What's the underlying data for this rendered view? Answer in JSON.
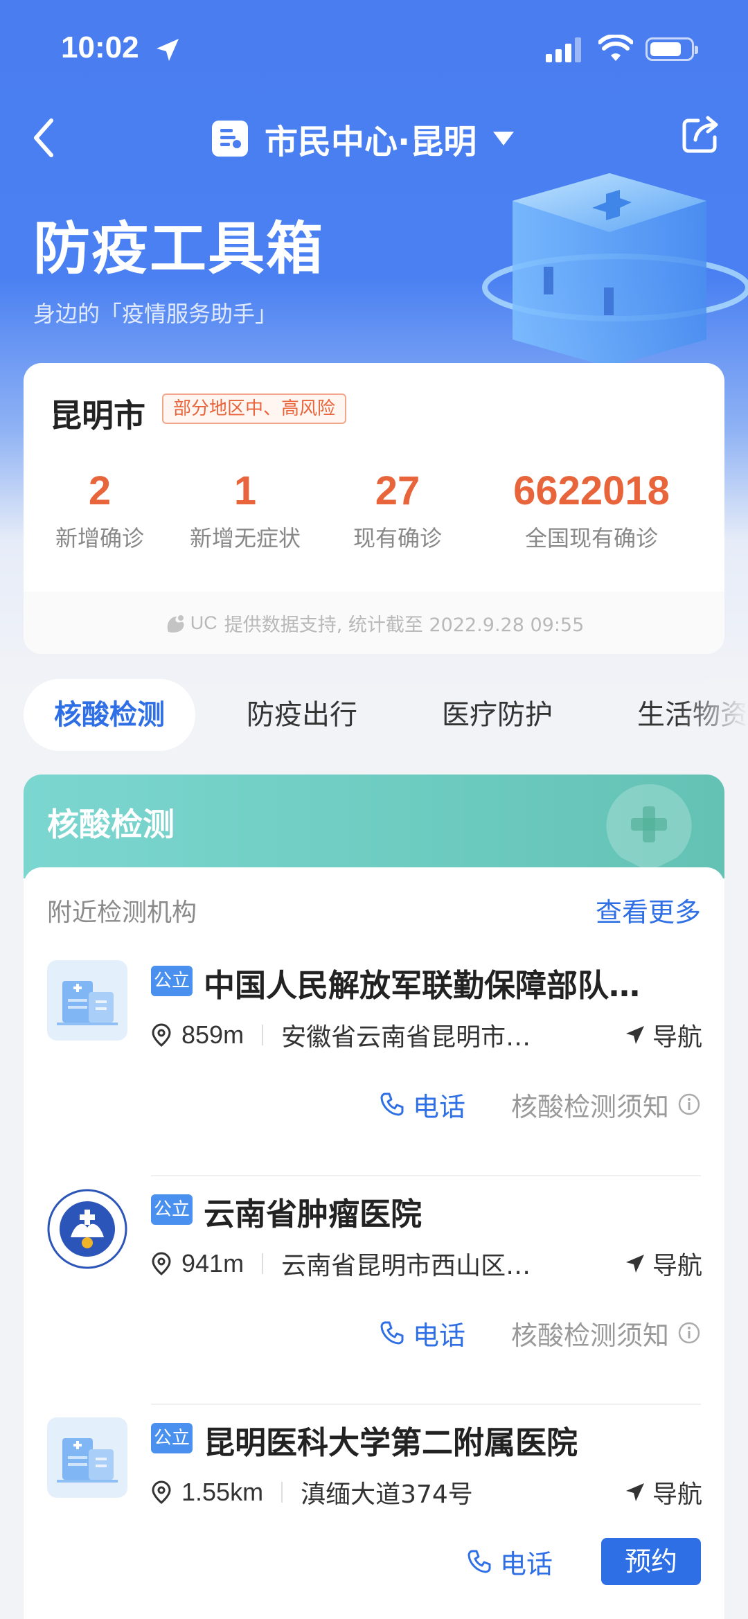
{
  "status": {
    "time": "10:02"
  },
  "nav": {
    "title": "市民中心·昆明"
  },
  "hero": {
    "title": "防疫工具箱",
    "subtitle": "身边的「疫情服务助手」"
  },
  "stats_card": {
    "city": "昆明市",
    "risk_badge": "部分地区中、高风险",
    "stats": [
      {
        "value": "2",
        "label": "新增确诊"
      },
      {
        "value": "1",
        "label": "新增无症状"
      },
      {
        "value": "27",
        "label": "现有确诊"
      },
      {
        "value": "6622018",
        "label": "全国现有确诊"
      }
    ],
    "source_brand": "UC",
    "source_text": "提供数据支持, 统计截至 2022.9.28 09:55"
  },
  "tabs": [
    "核酸检测",
    "防疫出行",
    "医疗防护",
    "生活物资"
  ],
  "active_tab": 0,
  "section": {
    "title": "核酸检测",
    "nearby_label": "附近检测机构",
    "more_label": "查看更多",
    "items": [
      {
        "badge": "公立",
        "name": "中国人民解放军联勤保障部队…",
        "distance": "859m",
        "address": "安徽省云南省昆明市…",
        "nav_label": "导航",
        "phone_label": "电话",
        "notice_label": "核酸检测须知"
      },
      {
        "badge": "公立",
        "name": "云南省肿瘤医院",
        "distance": "941m",
        "address": "云南省昆明市西山区…",
        "nav_label": "导航",
        "phone_label": "电话",
        "notice_label": "核酸检测须知"
      },
      {
        "badge": "公立",
        "name": "昆明医科大学第二附属医院",
        "distance": "1.55km",
        "address": "滇缅大道374号",
        "nav_label": "导航",
        "phone_label": "电话",
        "book_label": "预约"
      }
    ]
  },
  "colors": {
    "primary": "#4a7ef0",
    "accent_orange": "#e8643a",
    "link_blue": "#2f6fe6",
    "teal_header": "#6ccbbf"
  }
}
